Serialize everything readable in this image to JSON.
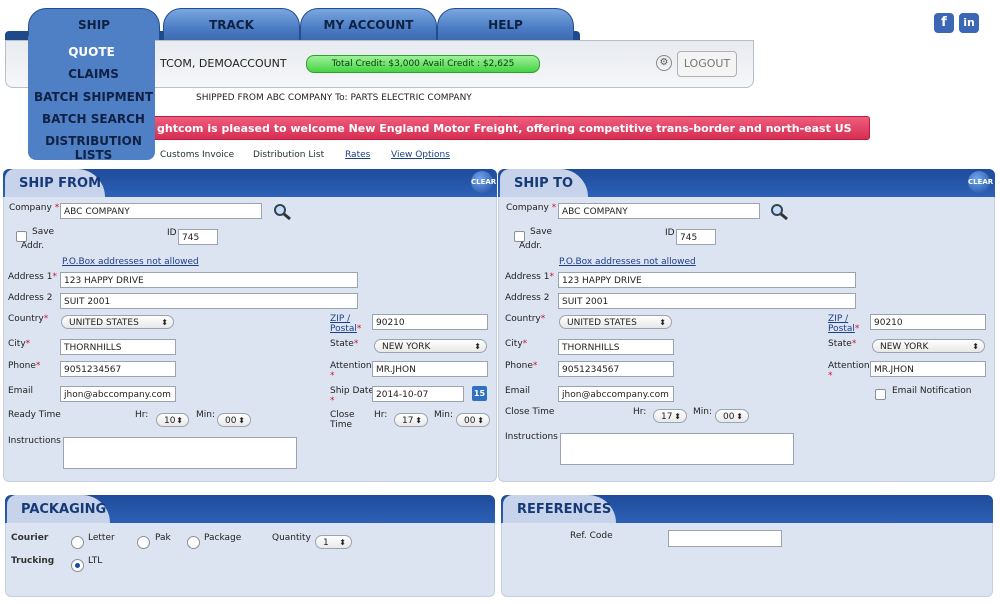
{
  "nav": {
    "tabs": [
      "SHIP",
      "TRACK",
      "MY ACCOUNT",
      "HELP"
    ],
    "dropdown": [
      "QUOTE",
      "CLAIMS",
      "BATCH SHIPMENT",
      "BATCH SEARCH",
      "DISTRIBUTION LISTS"
    ]
  },
  "header": {
    "welcome": "TCOM, DEMOACCOUNT",
    "credit": "Total Credit: $3,000  Avail Credit : $2,625",
    "logout": "LOGOUT",
    "shipped": "SHIPPED FROM  ABC COMPANY  To:  PARTS ELECTRIC COMPANY",
    "banner": "ghtcom is pleased to welcome New England Motor Freight, offering competitive trans-border and north-east US domestic pricing."
  },
  "social": {
    "fb": "f",
    "in": "in"
  },
  "links": {
    "customs": "Customs Invoice",
    "distribution": "Distribution List",
    "rates": "Rates",
    "view_options": "View Options"
  },
  "ship_from": {
    "title": "SHIP FROM",
    "clear": "CLEAR",
    "company_label": "Company",
    "company": "ABC COMPANY",
    "save_label": "Save",
    "addr_label": "Addr.",
    "id_label": "ID",
    "id": "745",
    "pobox": "P.O.Box addresses not allowed",
    "address1_label": "Address 1",
    "address1": "123 HAPPY DRIVE",
    "address2_label": "Address 2",
    "address2": "SUIT 2001",
    "country_label": "Country",
    "country": "UNITED STATES",
    "zip_label": "ZIP /",
    "postal_label": "Postal",
    "zip": "90210",
    "city_label": "City",
    "city": "THORNHILLS",
    "state_label": "State",
    "state": "NEW YORK",
    "phone_label": "Phone",
    "phone": "9051234567",
    "attention_label": "Attention",
    "attention": "MR.JHON",
    "email_label": "Email",
    "email": "jhon@abccompany.com",
    "shipdate_label": "Ship Date",
    "shipdate": "2014-10-07",
    "cal": "15",
    "ready_label": "Ready Time",
    "hr_label": "Hr:",
    "hr": "10",
    "min_label": "Min:",
    "min": "00",
    "close_label": "Close",
    "time_label": "Time",
    "close_hr": "17",
    "close_min": "00",
    "instructions_label": "Instructions"
  },
  "ship_to": {
    "title": "SHIP TO",
    "clear": "CLEAR",
    "company_label": "Company",
    "company": "ABC COMPANY",
    "save_label": "Save",
    "addr_label": "Addr.",
    "id_label": "ID",
    "id": "745",
    "pobox": "P.O.Box addresses not allowed",
    "address1_label": "Address 1",
    "address1": "123 HAPPY DRIVE",
    "address2_label": "Address 2",
    "address2": "SUIT 2001",
    "country_label": "Country",
    "country": "UNITED STATES",
    "zip_label": "ZIP /",
    "postal_label": "Postal",
    "zip": "90210",
    "city_label": "City",
    "city": "THORNHILLS",
    "state_label": "State",
    "state": "NEW YORK",
    "phone_label": "Phone",
    "phone": "9051234567",
    "attention_label": "Attention",
    "attention": "MR.JHON",
    "email_label": "Email",
    "email": "jhon@abccompany.com",
    "notify_label": "Email Notification",
    "close_label": "Close Time",
    "hr_label": "Hr:",
    "close_hr": "17",
    "min_label": "Min:",
    "close_min": "00",
    "instructions_label": "Instructions"
  },
  "packaging": {
    "title": "PACKAGING",
    "courier_label": "Courier",
    "letter": "Letter",
    "pak": "Pak",
    "package": "Package",
    "quantity_label": "Quantity",
    "quantity": "1",
    "trucking_label": "Trucking",
    "ltl": "LTL"
  },
  "references": {
    "title": "REFERENCES",
    "ref_label": "Ref. Code"
  }
}
